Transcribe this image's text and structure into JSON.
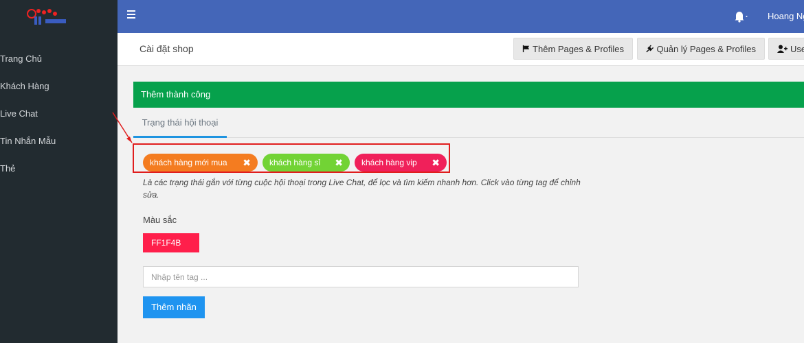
{
  "topbar": {
    "username": "Hoang Ng"
  },
  "sidebar": {
    "items": [
      {
        "label": "Trang Chủ"
      },
      {
        "label": "Khách Hàng"
      },
      {
        "label": "Live Chat"
      },
      {
        "label": "Tin Nhắn Mẫu"
      },
      {
        "label": "Thẻ"
      }
    ]
  },
  "header": {
    "title": "Cài đặt shop",
    "add_pages_label": "Thêm Pages & Profiles",
    "manage_pages_label": "Quản lý Pages & Profiles",
    "user_label": "Use"
  },
  "alert": {
    "text": "Thêm thành công"
  },
  "tabs": [
    {
      "label": "Trạng thái hội thoại"
    }
  ],
  "tags": [
    {
      "label": "khách hàng mới mua",
      "color": "#f47c20"
    },
    {
      "label": "khách hàng sỉ",
      "color": "#72d335"
    },
    {
      "label": "khách hàng vip",
      "color": "#f0205a"
    }
  ],
  "help_text": "Là các trạng thái gắn với từng cuộc hội thoại trong Live Chat, để lọc và tìm kiếm nhanh hơn. Click vào từng tag để chỉnh sửa.",
  "color": {
    "label": "Màu sắc",
    "value": "FF1F4B",
    "hex": "#ff1f4b"
  },
  "tag_input": {
    "placeholder": "Nhập tên tag ...",
    "value": ""
  },
  "submit_label": "Thêm nhãn",
  "theme": {
    "topbar": "#4466b8",
    "sidebar": "#222b30",
    "alert": "#06a14c",
    "accent": "#1f94f0",
    "highlight": "#e01d1d"
  }
}
